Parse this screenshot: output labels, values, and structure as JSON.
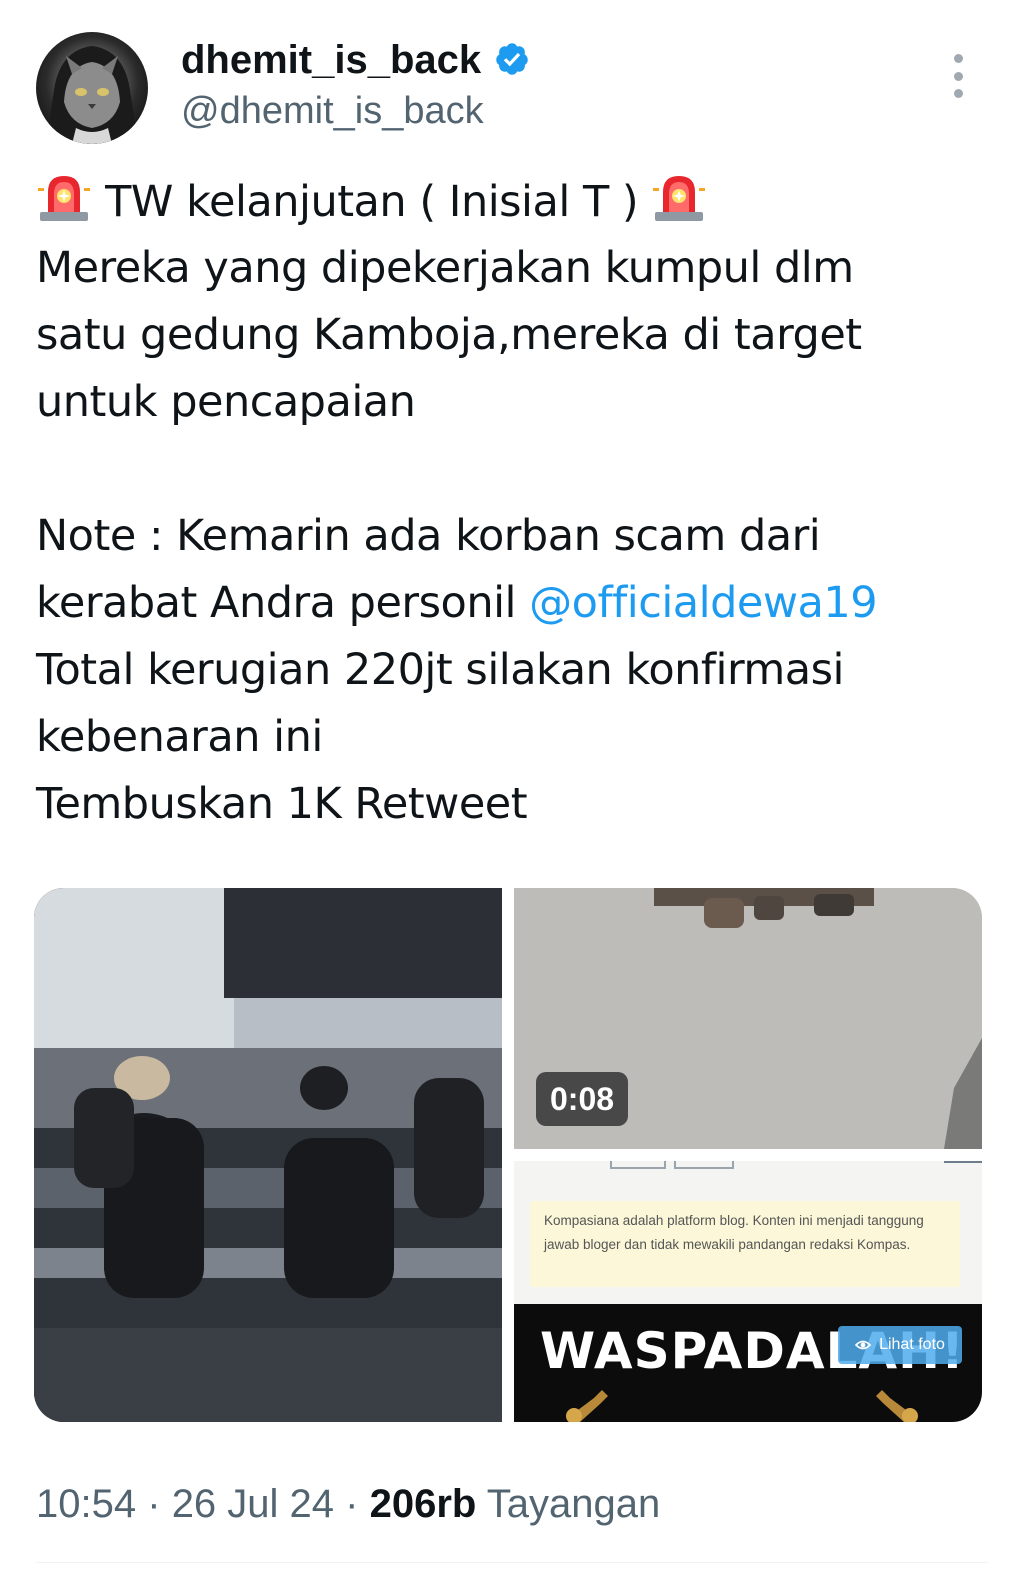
{
  "author": {
    "display_name": "dhemit_is_back",
    "handle": "@dhemit_is_back",
    "verified_icon": "verified-badge-icon",
    "verified_color": "#1d9bf0"
  },
  "tweet": {
    "line1_text": " TW  kelanjutan ( Inisial T ) ",
    "line2": "Mereka yang dipekerjakan kumpul dlm",
    "line3": "satu gedung Kamboja,mereka di target",
    "line4": "untuk pencapaian",
    "line5": "Note : Kemarin ada korban scam dari",
    "line6_text": "kerabat Andra personil ",
    "mention": "@officialdewa19",
    "line7": "Total kerugian 220jt silakan konfirmasi",
    "line8": "kebenaran ini",
    "line9": "Tembuskan 1K Retweet",
    "emoji_icon": "police-car-light-icon",
    "mention_color": "#1d9bf0"
  },
  "media": {
    "video_duration": "0:08",
    "notice_text": "Kompasiana adalah platform blog. Konten ini menjadi tanggung jawab bloger dan tidak mewakili pandangan redaksi Kompas.",
    "banner_text": "WASPADALAH!",
    "view_photo_label": "Lihat foto"
  },
  "footer": {
    "time": "10:54",
    "date": "26 Jul 24",
    "views_count": "206rb",
    "views_label": "Tayangan",
    "separator": "·"
  }
}
